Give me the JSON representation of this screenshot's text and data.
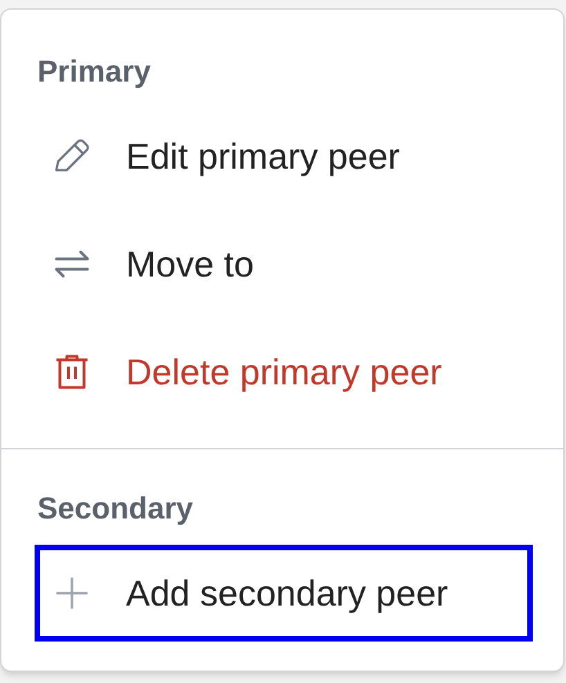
{
  "sections": [
    {
      "heading": "Primary",
      "items": [
        {
          "kind": "edit",
          "label": "Edit primary peer",
          "danger": false,
          "focused": false
        },
        {
          "kind": "move",
          "label": "Move to",
          "danger": false,
          "focused": false
        },
        {
          "kind": "delete",
          "label": "Delete primary peer",
          "danger": true,
          "focused": false
        }
      ]
    },
    {
      "heading": "Secondary",
      "items": [
        {
          "kind": "add",
          "label": "Add secondary peer",
          "danger": false,
          "focused": true
        }
      ]
    }
  ]
}
